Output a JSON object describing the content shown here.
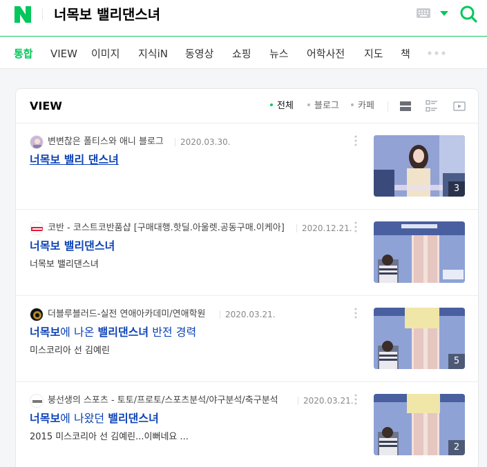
{
  "header": {
    "logo_icon": "naver-n-logo",
    "query": "너목보 밸리댄스녀",
    "keyboard_icon": "keyboard-icon",
    "dropdown_icon": "caret-down-icon",
    "search_icon": "search-icon",
    "accent_color": "#03c75a"
  },
  "tabs": [
    {
      "label": "통합",
      "active": true
    },
    {
      "label": "VIEW"
    },
    {
      "label": "이미지"
    },
    {
      "label": "지식iN"
    },
    {
      "label": "동영상"
    },
    {
      "label": "쇼핑"
    },
    {
      "label": "뉴스"
    },
    {
      "label": "어학사전"
    },
    {
      "label": "지도"
    },
    {
      "label": "책"
    }
  ],
  "view_section": {
    "title": "VIEW",
    "filters": [
      {
        "label": "전체",
        "active": true
      },
      {
        "label": "블로그"
      },
      {
        "label": "카페"
      }
    ],
    "view_icons": [
      "list-view-icon",
      "detail-view-icon",
      "video-view-icon"
    ],
    "items": [
      {
        "source": "변변찮은 폴티스와 애니 블로그",
        "date": "2020.03.30.",
        "title": "너목보 밸리 댄스녀",
        "description": "",
        "thumb_count": "3"
      },
      {
        "source": "코반 - 코스트코반품샵 [구매대행.핫딜.아울렛.공동구매.이케아]",
        "date": "2020.12.21.",
        "title": "너목보 밸리댄스녀",
        "description": "너목보 밸리댄스녀",
        "thumb_count": ""
      },
      {
        "source": "더블루블러드-실전 연애아카데미/연애학원",
        "date": "2020.03.21.",
        "title_parts": [
          "너목보",
          "에 나온 ",
          "밸리댄스녀",
          " 반전 경력"
        ],
        "description": "미스코리아 선 김예린",
        "thumb_count": "5"
      },
      {
        "source": "붕선생의 스포츠 - 토토/프로토/스포츠분석/야구분석/축구분석",
        "date": "2020.03.21.",
        "title_parts": [
          "너목보",
          "에 나왔던 ",
          "밸리댄스녀",
          ""
        ],
        "description": "2015 미스코리아 선 김예린...이뻐네요 ...",
        "thumb_count": "2"
      }
    ]
  }
}
